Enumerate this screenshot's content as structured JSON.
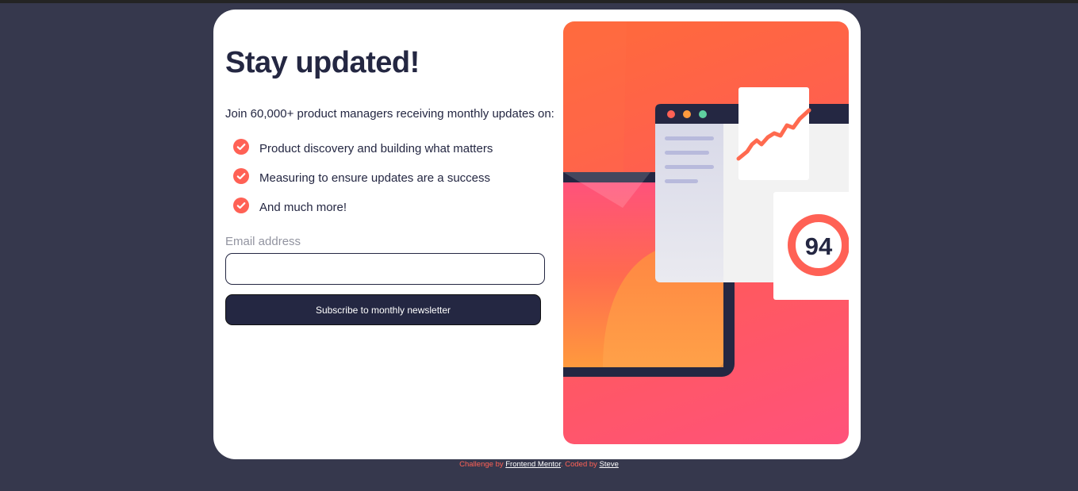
{
  "signup": {
    "title": "Stay updated!",
    "intro": "Join 60,000+ product managers receiving monthly updates on:",
    "features": [
      "Product discovery and building what matters",
      "Measuring to ensure updates are a success",
      "And much more!"
    ],
    "email_label": "Email address",
    "email_value": "",
    "email_placeholder": "",
    "button_label": "Subscribe to monthly newsletter"
  },
  "illustration": {
    "score": "94"
  },
  "footer": {
    "challenge_prefix": "Challenge by",
    "challenge_link": "Frontend Mentor",
    "coded_prefix": ". Coded by",
    "author_link": "Steve"
  },
  "colors": {
    "background": "#36384d",
    "card": "#ffffff",
    "text": "#242742",
    "accent": "#ff6155",
    "muted": "#9294a0",
    "button": "#242742"
  },
  "icons": {
    "feature": "check-circle-icon"
  }
}
